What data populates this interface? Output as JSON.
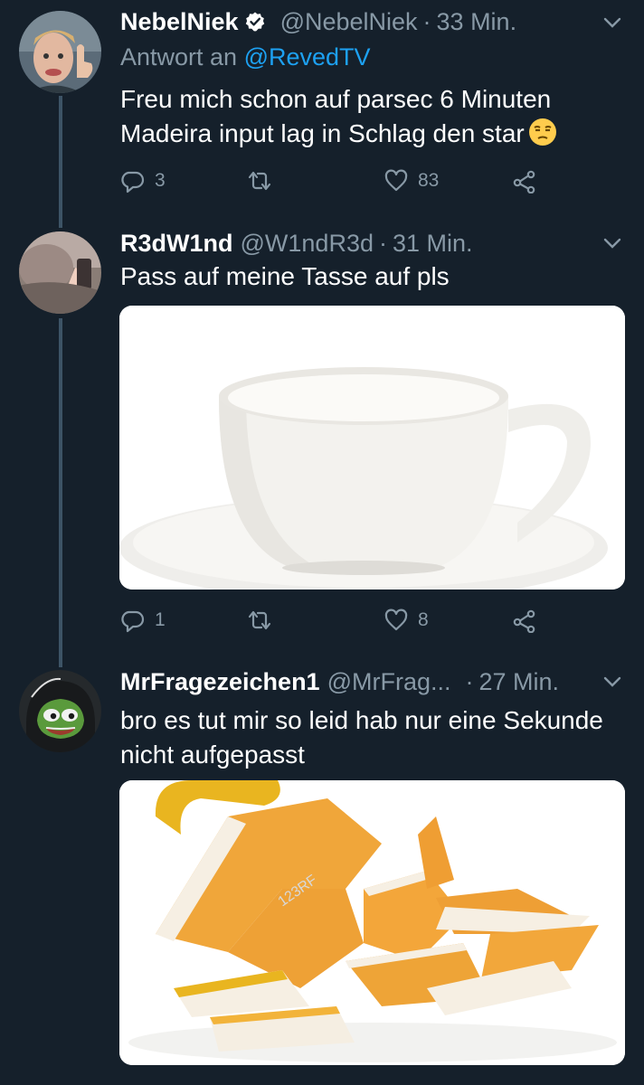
{
  "tweets": [
    {
      "name": "NebelNiek",
      "handle": "@NebelNiek",
      "dot": "·",
      "time": "33 Min.",
      "reply_prefix": "Antwort an",
      "reply_mention": "@RevedTV",
      "text": "Freu mich schon auf parsec 6 Minuten Madeira input lag in Schlag den star",
      "emoji": "unamused-face-icon",
      "replies": "3",
      "retweets": "",
      "likes": "83"
    },
    {
      "name": "R3dW1nd",
      "handle": "@W1ndR3d",
      "dot": "·",
      "time": "31 Min.",
      "text": "Pass auf meine Tasse auf pls",
      "media": "white-cup-photo",
      "replies": "1",
      "retweets": "",
      "likes": "8"
    },
    {
      "name": "MrFragezeichen1",
      "handle": "@MrFrag...",
      "dot": "·",
      "time": "27 Min.",
      "text": "bro es tut mir so leid hab nur eine Sekunde nicht aufgepasst",
      "media": "broken-cup-photo",
      "watermark": "123RF"
    }
  ],
  "colors": {
    "background": "#15202b",
    "secondary_text": "#8899a6",
    "link": "#1da1f2",
    "thread_line": "#3d5466"
  }
}
